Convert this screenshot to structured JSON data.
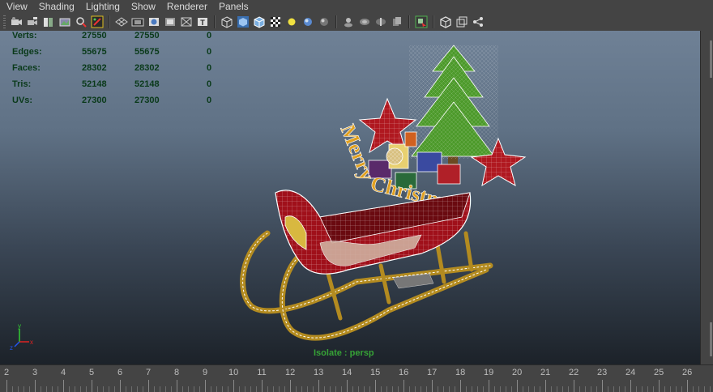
{
  "menu": [
    "View",
    "Shading",
    "Lighting",
    "Show",
    "Renderer",
    "Panels"
  ],
  "toolbar_icons": [
    "camera-icon",
    "camera-attributes-icon",
    "bookmark-icon",
    "image-plane-icon",
    "2d-pan-zoom-icon",
    "grease-pencil-icon",
    "grid-icon",
    "film-gate-icon",
    "resolution-gate-icon",
    "gate-mask-icon",
    "field-chart-icon",
    "safe-title-icon",
    "wireframe-icon",
    "smooth-shade-icon",
    "wireframe-on-shaded-icon",
    "textured-icon",
    "use-all-lights-icon",
    "shadows-icon",
    "ambient-occlusion-icon",
    "isolate-select-icon",
    "xray-icon",
    "xray-joints-icon",
    "xray-active-icon",
    "backface-culling-icon",
    "playblast-icon",
    "open-bracket-icon",
    "nested-windows-icon",
    "node-share-icon"
  ],
  "hud": {
    "rows": [
      {
        "label": "Verts:",
        "c1": "27550",
        "c2": "27550",
        "c3": "0"
      },
      {
        "label": "Edges:",
        "c1": "55675",
        "c2": "55675",
        "c3": "0"
      },
      {
        "label": "Faces:",
        "c1": "28302",
        "c2": "28302",
        "c3": "0"
      },
      {
        "label": "Tris:",
        "c1": "52148",
        "c2": "52148",
        "c3": "0"
      },
      {
        "label": "UVs:",
        "c1": "27300",
        "c2": "27300",
        "c3": "0"
      }
    ]
  },
  "viewport": {
    "isolate_label": "Isolate : persp",
    "axis": {
      "x": "x",
      "y": "y",
      "z": "z"
    },
    "scene_text": "Merry Christmas!",
    "colors": {
      "sleigh_red": "#a0101a",
      "sleigh_gold": "#b38b20",
      "tree_green": "#4c9a2a",
      "star_red": "#b01820",
      "wire": "#ffffff"
    }
  },
  "timeline": {
    "frames": [
      "2",
      "3",
      "4",
      "5",
      "6",
      "7",
      "8",
      "9",
      "10",
      "11",
      "12",
      "13",
      "14",
      "15",
      "16",
      "17",
      "18",
      "19",
      "20",
      "21",
      "22",
      "23",
      "24",
      "25",
      "26"
    ]
  }
}
